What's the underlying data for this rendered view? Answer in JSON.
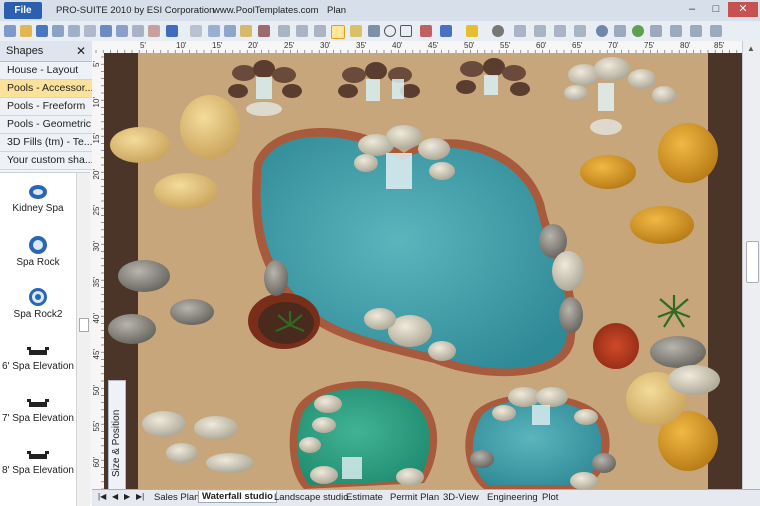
{
  "title": {
    "file_label": "File",
    "app": "PRO-SUITE 2010 by ESI Corporation",
    "url": "www.PoolTemplates.com",
    "view": "Plan"
  },
  "shapes_panel": {
    "header": "Shapes",
    "categories": [
      {
        "label": "House - Layout"
      },
      {
        "label": "Pools - Accessor..."
      },
      {
        "label": "Pools  - Freeform"
      },
      {
        "label": "Pools - Geometric"
      },
      {
        "label": "3D Fills (tm) - Te..."
      },
      {
        "label": "Your custom sha..."
      }
    ],
    "items": [
      {
        "label": "Kidney Spa"
      },
      {
        "label": "Spa Rock"
      },
      {
        "label": "Spa Rock2"
      },
      {
        "label": "6' Spa Elevation"
      },
      {
        "label": "7' Spa Elevation"
      },
      {
        "label": "8' Spa Elevation"
      }
    ]
  },
  "ruler": {
    "top": [
      "5'",
      "10'",
      "15'",
      "20'",
      "25'",
      "30'",
      "35'",
      "40'",
      "45'",
      "50'",
      "55'",
      "60'",
      "65'",
      "70'",
      "75'",
      "80'",
      "85'"
    ],
    "left": [
      "5'",
      "10'",
      "15'",
      "20'",
      "25'",
      "30'",
      "35'",
      "40'",
      "45'",
      "50'",
      "55'",
      "60'"
    ]
  },
  "side_tab": "Size & Position",
  "tabs": [
    {
      "label": "Sales Plan"
    },
    {
      "label": "Waterfall studio"
    },
    {
      "label": "Landscape studio"
    },
    {
      "label": "Estimate"
    },
    {
      "label": "Permit Plan"
    },
    {
      "label": "3D-View"
    },
    {
      "label": "Engineering"
    },
    {
      "label": "Plot"
    }
  ],
  "colors": {
    "sand": "#c8a67c",
    "water": "#3e9aa6",
    "water_green": "#2f9f86",
    "pool_edge": "#9a5a3c",
    "mulch": "#4b3428",
    "rock_yellow": "#e3c37a",
    "rock_gold": "#d89a28",
    "rock_grey": "#8e8c86"
  }
}
